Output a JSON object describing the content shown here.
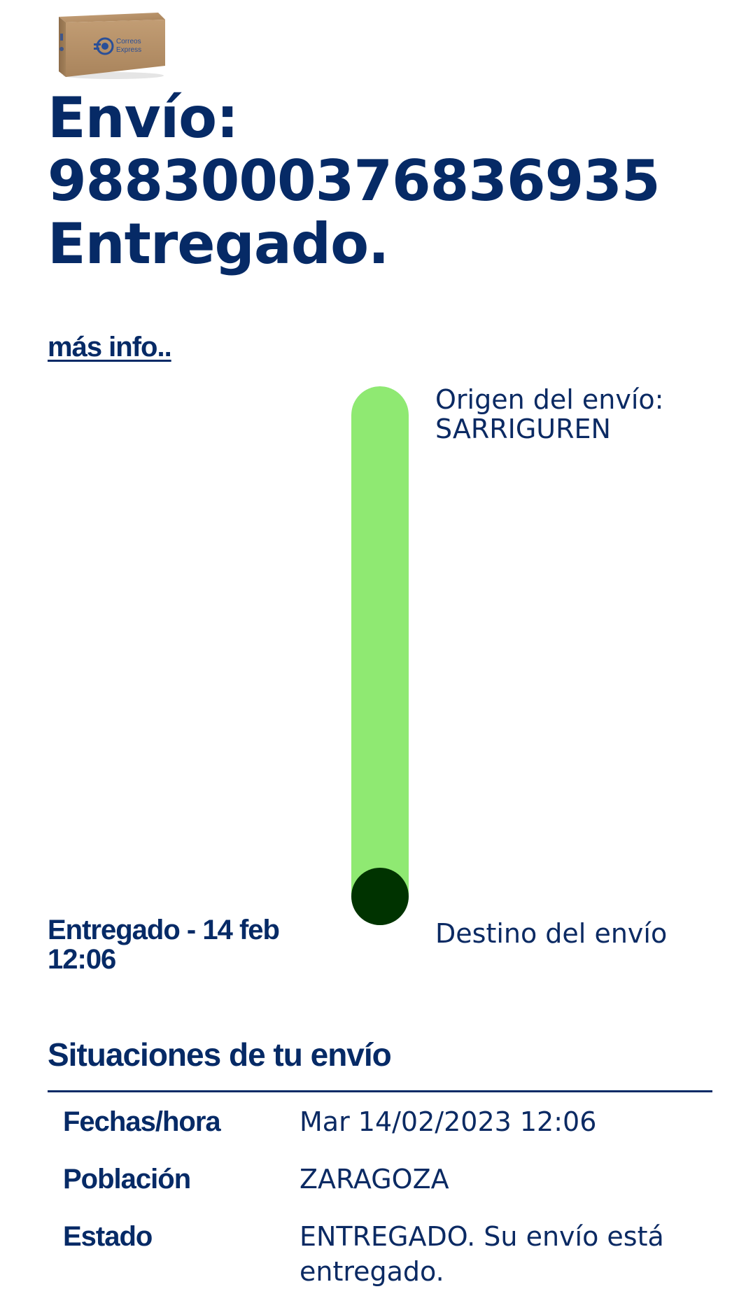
{
  "header": {
    "image_icon": "correos-express-box-icon",
    "brand_text": "Correos Express"
  },
  "shipment": {
    "title_line1": "Envío:",
    "tracking_number": "9883000376836935",
    "status_title": "Entregado."
  },
  "more_info_link": "más info..",
  "tracking": {
    "origin_label": "Origen del envío:",
    "origin_place": "SARRIGUREN",
    "destination_label": "Destino del envío",
    "delivered_label_line1": "Entregado - 14 feb",
    "delivered_label_line2": "12:06",
    "progress": 1.0,
    "colors": {
      "progress_fill": "#8fe972",
      "current_dot": "#003300"
    }
  },
  "situations": {
    "title": "Situaciones de tu envío",
    "rows": [
      {
        "key": "Fechas/hora",
        "value": "Mar 14/02/2023 12:06"
      },
      {
        "key": "Población",
        "value": "ZARAGOZA"
      },
      {
        "key": "Estado",
        "value": "ENTREGADO. Su envío está entregado."
      }
    ]
  },
  "colors": {
    "primary_text": "#062a66",
    "background": "#ffffff"
  }
}
